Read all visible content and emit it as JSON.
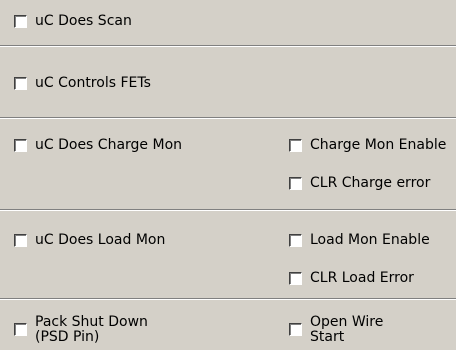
{
  "checkboxes": {
    "uc_does_scan": "uC Does Scan",
    "uc_controls_fets": "uC Controls FETs",
    "uc_does_charge_mon": "uC Does Charge Mon",
    "charge_mon_enable": "Charge Mon Enable",
    "clr_charge_error": "CLR Charge error",
    "uc_does_load_mon": "uC Does Load Mon",
    "load_mon_enable": "Load Mon Enable",
    "clr_load_error": "CLR Load Error",
    "pack_shut_down": "Pack Shut Down\n(PSD Pin)",
    "open_wire_start": "Open Wire\nStart"
  },
  "states": {
    "uc_does_scan": false,
    "uc_controls_fets": false,
    "uc_does_charge_mon": false,
    "charge_mon_enable": false,
    "clr_charge_error": false,
    "uc_does_load_mon": false,
    "load_mon_enable": false,
    "clr_load_error": false,
    "pack_shut_down": false,
    "open_wire_start": false
  }
}
